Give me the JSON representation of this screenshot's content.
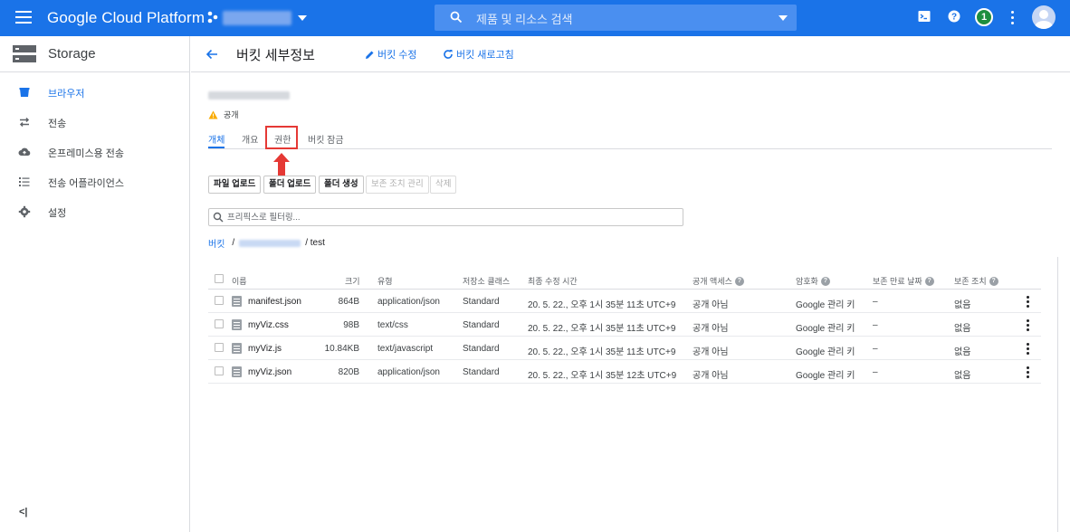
{
  "topbar": {
    "brand": "Google Cloud Platform",
    "search_placeholder": "제품 및 리소스 검색",
    "notification_count": "1"
  },
  "sidebar": {
    "title": "Storage",
    "items": [
      {
        "label": "브라우저",
        "icon": "bucket-icon",
        "active": true
      },
      {
        "label": "전송",
        "icon": "transfer-icon"
      },
      {
        "label": "온프레미스용 전송",
        "icon": "cloud-upload-icon"
      },
      {
        "label": "전송 어플라이언스",
        "icon": "appliance-list-icon"
      },
      {
        "label": "설정",
        "icon": "gear-icon"
      }
    ],
    "collapse_label": "<|"
  },
  "header": {
    "title": "버킷 세부정보",
    "edit_label": "버킷 수정",
    "refresh_label": "버킷 새로고침"
  },
  "bucket": {
    "access_label": "공개"
  },
  "tabs": [
    {
      "label": "개체",
      "active": true
    },
    {
      "label": "개요"
    },
    {
      "label": "권한"
    },
    {
      "label": "버킷 잠금"
    }
  ],
  "toolbar": {
    "upload_files": "파일 업로드",
    "upload_folder": "폴더 업로드",
    "create_folder": "폴더 생성",
    "manage_holds": "보존 조치 관리",
    "delete": "삭제"
  },
  "filter": {
    "placeholder": "프리픽스로 필터링..."
  },
  "breadcrumb": {
    "root": "버킷",
    "sep": "/",
    "folder": "/ test"
  },
  "table": {
    "headers": {
      "name": "이름",
      "size": "크기",
      "type": "유형",
      "storage_class": "저장소 클래스",
      "modified": "최종 수정 시간",
      "public_access": "공개 액세스",
      "encryption": "암호화",
      "retention_expiry": "보존 만료 날짜",
      "hold": "보존 조치"
    },
    "rows": [
      {
        "name": "manifest.json",
        "size": "864B",
        "type": "application/json",
        "storage_class": "Standard",
        "modified": "20. 5. 22., 오후 1시 35분 11초 UTC+9",
        "public_access": "공개 아님",
        "encryption": "Google 관리 키",
        "retention_expiry": "–",
        "hold": "없음"
      },
      {
        "name": "myViz.css",
        "size": "98B",
        "type": "text/css",
        "storage_class": "Standard",
        "modified": "20. 5. 22., 오후 1시 35분 11초 UTC+9",
        "public_access": "공개 아님",
        "encryption": "Google 관리 키",
        "retention_expiry": "–",
        "hold": "없음"
      },
      {
        "name": "myViz.js",
        "size": "10.84KB",
        "type": "text/javascript",
        "storage_class": "Standard",
        "modified": "20. 5. 22., 오후 1시 35분 11초 UTC+9",
        "public_access": "공개 아님",
        "encryption": "Google 관리 키",
        "retention_expiry": "–",
        "hold": "없음"
      },
      {
        "name": "myViz.json",
        "size": "820B",
        "type": "application/json",
        "storage_class": "Standard",
        "modified": "20. 5. 22., 오후 1시 35분 12초 UTC+9",
        "public_access": "공개 아님",
        "encryption": "Google 관리 키",
        "retention_expiry": "–",
        "hold": "없음"
      }
    ]
  },
  "colors": {
    "primary": "#1a73e8",
    "highlight": "#e53935",
    "warning": "#f9ab00"
  }
}
